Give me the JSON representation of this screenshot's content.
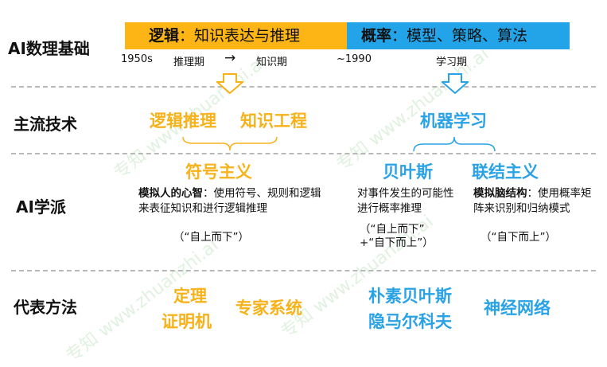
{
  "rows": {
    "foundation": "AI数理基础",
    "mainstream": "主流技术",
    "schools": "AI学派",
    "methods": "代表方法"
  },
  "banners": {
    "logic": {
      "title": "逻辑",
      "rest": "：知识表达与推理"
    },
    "probability": {
      "title": "概率",
      "rest": "：模型、策略、算法"
    }
  },
  "timeline": {
    "start_year": "1950s",
    "reasoning": "推理期",
    "arrow": "→",
    "knowledge": "知识期",
    "year_1990": "~1990",
    "learning": "学习期"
  },
  "mainstream": {
    "logic_reasoning": "逻辑推理",
    "knowledge_eng": "知识工程",
    "machine_learning": "机器学习"
  },
  "schools": {
    "symbolism": {
      "name": "符号主义",
      "desc_bold": "模拟人的心智",
      "desc_rest": "：使用符号、规则和逻辑来表征知识和进行逻辑推理",
      "direction": "（“自上而下”）"
    },
    "bayesian": {
      "name": "贝叶斯",
      "desc": "对事件发生的可能性进行概率推理",
      "direction1": "（“自上而下”",
      "direction2": "+“自下而上”）"
    },
    "connectionism": {
      "name": "联结主义",
      "desc_bold": "模拟脑结构",
      "desc_rest": "：使用概率矩阵来识别和归纳模式",
      "direction": "（“自下而上”）"
    }
  },
  "methods": {
    "theorem_1": "定理",
    "theorem_2": "证明机",
    "expert_system": "专家系统",
    "naive_bayes_1": "朴素贝叶斯",
    "naive_bayes_2": "隐马尔科夫",
    "neural_net": "神经网络"
  },
  "watermark": {
    "zh": "专知",
    "url": "www.zhuanzhi.ai"
  },
  "colors": {
    "orange": "#f7b21a",
    "blue": "#2aa2e6",
    "banner_orange": "#fdb515",
    "banner_blue": "#23a3e8"
  }
}
